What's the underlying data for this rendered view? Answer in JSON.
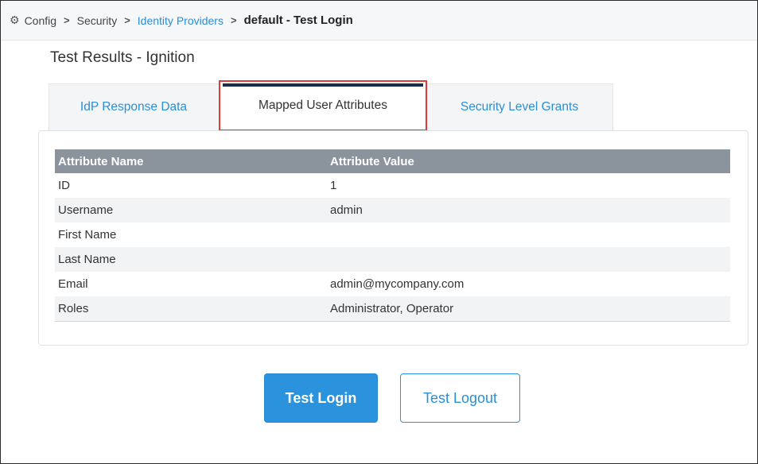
{
  "breadcrumb": {
    "icon": "gear-icon",
    "items": [
      "Config",
      "Security",
      "Identity Providers",
      "default - Test Login"
    ],
    "separator": ">"
  },
  "page": {
    "title": "Test Results - Ignition"
  },
  "tabs": [
    {
      "label": "IdP Response Data",
      "active": false
    },
    {
      "label": "Mapped User Attributes",
      "active": true
    },
    {
      "label": "Security Level Grants",
      "active": false
    }
  ],
  "table": {
    "headers": [
      "Attribute Name",
      "Attribute Value"
    ],
    "rows": [
      {
        "name": "ID",
        "value": "1"
      },
      {
        "name": "Username",
        "value": "admin"
      },
      {
        "name": "First Name",
        "value": ""
      },
      {
        "name": "Last Name",
        "value": ""
      },
      {
        "name": "Email",
        "value": "admin@mycompany.com"
      },
      {
        "name": "Roles",
        "value": "Administrator, Operator"
      }
    ]
  },
  "buttons": {
    "test_login": "Test Login",
    "test_logout": "Test Logout"
  },
  "colors": {
    "link": "#2a8fd6",
    "primary_button": "#2b93dd",
    "table_header": "#8b949c",
    "highlight_box": "#e53935",
    "active_tab_bar": "#1b2f4a"
  }
}
